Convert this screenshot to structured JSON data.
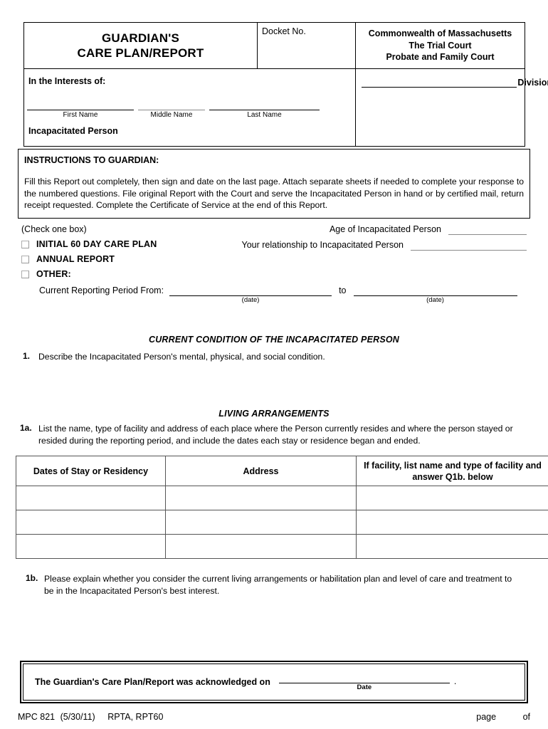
{
  "header": {
    "form_title_line1": "GUARDIAN'S",
    "form_title_line2": "CARE PLAN/REPORT",
    "docket_label": "Docket No.",
    "court_line1": "Commonwealth of Massachusetts",
    "court_line2": "The Trial Court",
    "court_line3": "Probate and Family Court",
    "division_label": "Division",
    "interests_label": "In the Interests of:",
    "name_first_caption": "First Name",
    "name_middle_caption": "Middle Name",
    "name_last_caption": "Last Name",
    "incapacitated_label": "Incapacitated Person"
  },
  "instructions": {
    "heading": "INSTRUCTIONS TO GUARDIAN:",
    "body": "Fill this Report out completely, then sign and date on the last page.  Attach separate sheets if needed to complete your response to the numbered questions.  File original Report with the Court and serve the Incapacitated Person in hand or by certified mail, return receipt requested.  Complete the Certificate of Service at the end of this Report."
  },
  "report_type": {
    "check_one_label": "(Check one box)",
    "options": [
      {
        "label": "INITIAL 60 DAY CARE PLAN",
        "checked": false
      },
      {
        "label": "ANNUAL REPORT",
        "checked": false
      },
      {
        "label": "OTHER:",
        "checked": false
      }
    ],
    "age_label": "Age of Incapacitated Person",
    "age_value": "",
    "relationship_label": "Your relationship to Incapacitated Person",
    "relationship_value": "",
    "period_label": "Current Reporting Period From:",
    "period_to_word": "to",
    "period_from_value": "",
    "period_to_value": "",
    "date_caption": "(date)"
  },
  "sections": {
    "condition_heading": "CURRENT CONDITION OF THE INCAPACITATED PERSON",
    "living_heading": "LIVING ARRANGEMENTS"
  },
  "questions": {
    "q1_num": "1.",
    "q1_text": "Describe the Incapacitated Person's mental, physical, and social condition.",
    "q1a_num": "1a.",
    "q1a_text": "List the name, type of facility and address of each place where the Person currently resides and where the person stayed or resided during the reporting period, and include the dates each stay or residence began and ended.",
    "q1b_num": "1b.",
    "q1b_text": "Please explain whether you consider the current living arrangements or habilitation plan and level of care and treatment to be in the Incapacitated Person's best interest."
  },
  "residency_table": {
    "columns": [
      "Dates of Stay or Residency",
      "Address",
      "If facility, list name and type of facility and answer Q1b. below"
    ],
    "rows": [
      [
        "",
        "",
        ""
      ],
      [
        "",
        "",
        ""
      ],
      [
        "",
        "",
        ""
      ]
    ]
  },
  "acknowledgment": {
    "text": "The Guardian's Care Plan/Report was acknowledged on",
    "date_value": "",
    "date_caption": "Date",
    "trailing_period": "."
  },
  "footer": {
    "form_number": "MPC 821",
    "revision_date": "(5/30/11)",
    "codes": "RPTA, RPT60",
    "page_label": "page",
    "of_label": "of",
    "page_number": "",
    "page_total": ""
  }
}
